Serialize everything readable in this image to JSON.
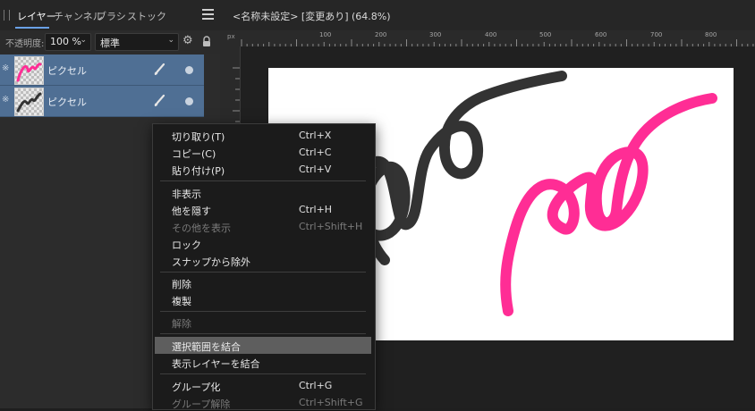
{
  "panel": {
    "tabs": [
      "レイヤー",
      "チャンネル",
      "ブラシ",
      "ストック"
    ],
    "active_tab": "レイヤー",
    "opacity_label": "不透明度:",
    "opacity_value": "100 %",
    "blend_mode": "標準",
    "layers": [
      {
        "name": "ピクセル",
        "stroke_color": "#ff2d95"
      },
      {
        "name": "ピクセル",
        "stroke_color": "#333333"
      }
    ]
  },
  "document": {
    "title": "<名称未設定> [変更あり] (64.8%)",
    "ruler_unit": "px",
    "ruler_labels": [
      "100",
      "200",
      "300",
      "400",
      "500",
      "600",
      "700",
      "800"
    ]
  },
  "context_menu": {
    "items": [
      {
        "label": "切り取り(T)",
        "shortcut": "Ctrl+X",
        "disabled": false
      },
      {
        "label": "コピー(C)",
        "shortcut": "Ctrl+C",
        "disabled": false
      },
      {
        "label": "貼り付け(P)",
        "shortcut": "Ctrl+V",
        "disabled": false
      },
      {
        "label": "非表示",
        "shortcut": "",
        "disabled": false
      },
      {
        "label": "他を隠す",
        "shortcut": "Ctrl+H",
        "disabled": false
      },
      {
        "label": "その他を表示",
        "shortcut": "Ctrl+Shift+H",
        "disabled": true
      },
      {
        "label": "ロック",
        "shortcut": "",
        "disabled": false
      },
      {
        "label": "スナップから除外",
        "shortcut": "",
        "disabled": false
      },
      {
        "label": "削除",
        "shortcut": "",
        "disabled": false
      },
      {
        "label": "複製",
        "shortcut": "",
        "disabled": false
      },
      {
        "label": "解除",
        "shortcut": "",
        "disabled": true
      },
      {
        "label": "選択範囲を結合",
        "shortcut": "",
        "disabled": false,
        "highlighted": true
      },
      {
        "label": "表示レイヤーを結合",
        "shortcut": "",
        "disabled": false
      },
      {
        "label": "グループ化",
        "shortcut": "Ctrl+G",
        "disabled": false
      },
      {
        "label": "グループ解除",
        "shortcut": "Ctrl+Shift+G",
        "disabled": true
      }
    ]
  },
  "colors": {
    "selection_blue": "#4f6f94",
    "accent": "#6aa1e6",
    "pink_stroke": "#ff2d95",
    "dark_stroke": "#333333"
  }
}
